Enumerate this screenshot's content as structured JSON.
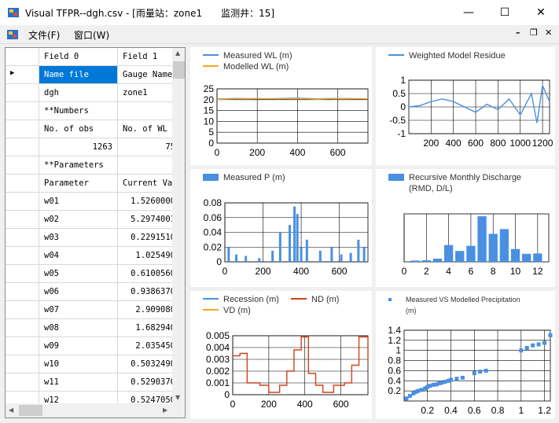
{
  "window": {
    "title": "Visual TFPR--dgh.csv - [雨量站：zone1　　监测井：15]",
    "minimize_glyph": "—",
    "maximize_glyph": "☐",
    "close_glyph": "✕"
  },
  "menu": {
    "items": [
      "文件(F)",
      "窗口(W)"
    ],
    "mdi_min": "–",
    "mdi_restore": "❐",
    "mdi_close": "✕"
  },
  "grid": {
    "headers": [
      "Field 0",
      "Field 1"
    ],
    "rows": [
      {
        "c0": "Name file",
        "c1": "Gauge Name",
        "selected": true,
        "pointer": "▶"
      },
      {
        "c0": "dgh",
        "c1": "zone1"
      },
      {
        "c0": "**Numbers",
        "c1": ""
      },
      {
        "c0": "No. of obs",
        "c1": "No. of WL"
      },
      {
        "c0": "1263",
        "c1": "75",
        "align": "right"
      },
      {
        "c0": "**Parameters",
        "c1": ""
      },
      {
        "c0": "Parameter",
        "c1": "Current Va"
      },
      {
        "c0": "w01",
        "c1": "1.5260000",
        "align1": "right"
      },
      {
        "c0": "w02",
        "c1": "5.2974001",
        "align1": "right"
      },
      {
        "c0": "w03",
        "c1": "0.2291510",
        "align1": "right"
      },
      {
        "c0": "w04",
        "c1": "1.025490",
        "align1": "right"
      },
      {
        "c0": "w05",
        "c1": "0.6100560",
        "align1": "right"
      },
      {
        "c0": "w06",
        "c1": "0.9386370",
        "align1": "right"
      },
      {
        "c0": "w07",
        "c1": "2.909080",
        "align1": "right"
      },
      {
        "c0": "w08",
        "c1": "1.682940",
        "align1": "right"
      },
      {
        "c0": "w09",
        "c1": "2.035450",
        "align1": "right"
      },
      {
        "c0": "w10",
        "c1": "0.5032490",
        "align1": "right"
      },
      {
        "c0": "w11",
        "c1": "0.5290370",
        "align1": "right"
      },
      {
        "c0": "w12",
        "c1": "0.5247050",
        "align1": "right"
      }
    ]
  },
  "colors": {
    "blue": "#4a90e2",
    "orange": "#f5a623",
    "red": "#d0421b"
  },
  "chart_data": [
    {
      "type": "line",
      "legend": [
        "Measured WL (m)",
        "Modelled WL (m)"
      ],
      "xlim": [
        0,
        750
      ],
      "ylim": [
        0,
        25
      ],
      "xticks": [
        0,
        200,
        400,
        600
      ],
      "yticks": [
        0,
        5,
        10,
        15,
        20,
        25
      ],
      "series": [
        {
          "name": "Measured WL (m)",
          "color": "#4a90e2",
          "x": [
            0,
            100,
            200,
            300,
            400,
            500,
            600,
            750
          ],
          "values": [
            20.3,
            20.6,
            20.4,
            20.5,
            20.7,
            20.4,
            20.6,
            20.4
          ]
        },
        {
          "name": "Modelled WL (m)",
          "color": "#f5a623",
          "x": [
            0,
            100,
            200,
            300,
            400,
            500,
            600,
            750
          ],
          "values": [
            20.1,
            20.4,
            20.6,
            20.3,
            20.5,
            20.2,
            20.5,
            20.3
          ]
        }
      ]
    },
    {
      "type": "line",
      "legend": [
        "Weighted Model Residue"
      ],
      "xlim": [
        0,
        1263
      ],
      "ylim": [
        -1,
        1
      ],
      "xticks": [
        200,
        400,
        600,
        800,
        1000,
        1200
      ],
      "yticks": [
        -1,
        -0.5,
        0,
        0.5,
        1
      ],
      "series": [
        {
          "name": "Weighted Model Residue",
          "color": "#4a90e2",
          "x": [
            0,
            100,
            200,
            300,
            400,
            500,
            600,
            700,
            800,
            900,
            1000,
            1100,
            1150,
            1200,
            1263
          ],
          "values": [
            0.0,
            0.05,
            0.2,
            0.3,
            0.2,
            0.0,
            -0.2,
            0.1,
            -0.1,
            0.3,
            -0.3,
            0.5,
            -0.6,
            0.8,
            0.2
          ]
        }
      ]
    },
    {
      "type": "bar",
      "legend": [
        "Measured P (m)"
      ],
      "xlim": [
        0,
        750
      ],
      "ylim": [
        0,
        0.08
      ],
      "xticks": [
        0,
        200,
        400,
        600
      ],
      "yticks": [
        0,
        0.02,
        0.04,
        0.06,
        0.08
      ],
      "x": [
        20,
        60,
        110,
        180,
        250,
        290,
        340,
        365,
        380,
        400,
        430,
        500,
        560,
        610,
        660,
        700,
        730
      ],
      "values": [
        0.02,
        0.01,
        0.008,
        0.005,
        0.015,
        0.04,
        0.05,
        0.075,
        0.065,
        0.02,
        0.03,
        0.015,
        0.02,
        0.01,
        0.012,
        0.03,
        0.02
      ],
      "color": "#4a90e2"
    },
    {
      "type": "bar",
      "legend": [
        "Recursive Monthly Discharge",
        "(RMD, D/L)"
      ],
      "xlim": [
        0,
        13
      ],
      "ylim": [
        0,
        3
      ],
      "xticks": [
        0,
        2,
        4,
        6,
        8,
        10,
        12
      ],
      "x": [
        1,
        2,
        3,
        4,
        5,
        6,
        7,
        8,
        9,
        10,
        11,
        12
      ],
      "values": [
        0.08,
        0.1,
        0.2,
        1.05,
        0.68,
        1.0,
        2.85,
        1.75,
        2.05,
        0.8,
        0.5,
        0.52
      ],
      "color": "#4a90e2"
    },
    {
      "type": "line",
      "legend": [
        "Recession (m)",
        "ND (m)",
        "VD (m)"
      ],
      "xlim": [
        0,
        750
      ],
      "ylim": [
        0,
        0.005
      ],
      "xticks": [
        0,
        200,
        400,
        600
      ],
      "yticks": [
        0,
        0.001,
        0.002,
        0.003,
        0.004,
        0.005
      ],
      "series": [
        {
          "name": "ND (m)",
          "color": "#d0421b",
          "x": [
            0,
            40,
            80,
            150,
            200,
            260,
            300,
            340,
            380,
            420,
            460,
            500,
            560,
            620,
            660,
            700,
            750
          ],
          "values": [
            0.0033,
            0.0035,
            0.001,
            0.0008,
            0.0002,
            0.0008,
            0.002,
            0.0038,
            0.0049,
            0.0018,
            0.0008,
            0.0002,
            0.0008,
            0.001,
            0.0025,
            0.0049,
            0.0028
          ]
        }
      ]
    },
    {
      "type": "scatter",
      "legend": [
        "Measured VS Modelled Precipitation",
        "(m)"
      ],
      "xlim": [
        0,
        1.25
      ],
      "ylim": [
        0,
        1.4
      ],
      "xticks": [
        0.2,
        0.4,
        0.6,
        0.8,
        1.0,
        1.2
      ],
      "yticks": [
        0.2,
        0.4,
        0.6,
        0.8,
        1.0,
        1.2,
        1.4
      ],
      "x": [
        0.02,
        0.05,
        0.08,
        0.1,
        0.12,
        0.15,
        0.18,
        0.2,
        0.22,
        0.25,
        0.28,
        0.3,
        0.32,
        0.35,
        0.38,
        0.4,
        0.45,
        0.5,
        0.6,
        0.65,
        0.7,
        1.0,
        1.05,
        1.1,
        1.15,
        1.2,
        1.25
      ],
      "values": [
        0.05,
        0.1,
        0.15,
        0.18,
        0.2,
        0.22,
        0.25,
        0.28,
        0.3,
        0.32,
        0.33,
        0.35,
        0.36,
        0.38,
        0.4,
        0.42,
        0.44,
        0.46,
        0.55,
        0.58,
        0.6,
        1.0,
        1.05,
        1.1,
        1.12,
        1.15,
        1.3
      ],
      "color": "#4a90e2"
    }
  ]
}
